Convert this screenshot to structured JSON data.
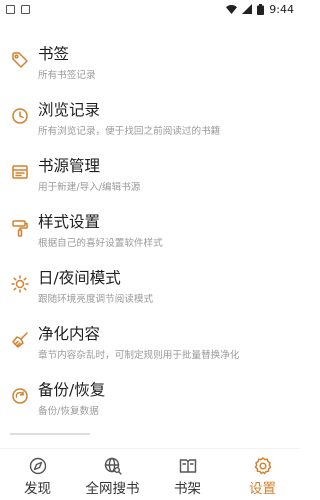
{
  "status_bar": {
    "time": "9:44"
  },
  "theme": {
    "accent": "#d4812d",
    "title_color": "#1e1e1e",
    "desc_color": "#9a9a9a"
  },
  "settings": [
    {
      "icon": "tag-icon",
      "title": "书签",
      "desc": "所有书签记录"
    },
    {
      "icon": "clock-icon",
      "title": "浏览记录",
      "desc": "所有浏览记录，便于找回之前阅读过的书籍"
    },
    {
      "icon": "book-source-icon",
      "title": "书源管理",
      "desc": "用于新建/导入/编辑书源"
    },
    {
      "icon": "paint-roller-icon",
      "title": "样式设置",
      "desc": "根据自己的喜好设置软件样式"
    },
    {
      "icon": "sun-icon",
      "title": "日/夜间模式",
      "desc": "跟随环境亮度调节阅读模式"
    },
    {
      "icon": "broom-icon",
      "title": "净化内容",
      "desc": "章节内容杂乱时，可制定规则用于批量替换净化"
    },
    {
      "icon": "backup-icon",
      "title": "备份/恢复",
      "desc": "备份/恢复数据"
    }
  ],
  "bottom_nav": [
    {
      "icon": "discover-icon",
      "label": "发现",
      "active": false
    },
    {
      "icon": "web-search-icon",
      "label": "全网搜书",
      "active": false
    },
    {
      "icon": "bookshelf-icon",
      "label": "书架",
      "active": false
    },
    {
      "icon": "settings-gear-icon",
      "label": "设置",
      "active": true
    }
  ]
}
